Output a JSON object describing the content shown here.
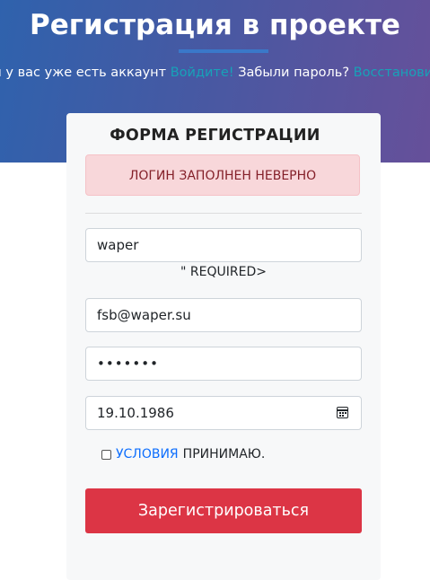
{
  "hero": {
    "title": "Регистрация в проекте",
    "sub_text1": "Если у вас уже есть аккаунт ",
    "login_link": "Войдите!",
    "sub_text2": " Забыли пароль? ",
    "restore_link": "Восстановить"
  },
  "form": {
    "title": "ФОРМА РЕГИСТРАЦИИ",
    "alert": "ЛОГИН ЗАПОЛНЕН НЕВЕРНО",
    "login_value": "waper",
    "required_note": "\" REQUIRED>",
    "email_value": "fsb@waper.su",
    "password_value": "•••••••",
    "birthdate_value": "19.10.1986",
    "terms_link": "УСЛОВИЯ",
    "terms_text": "ПРИНИМАЮ.",
    "submit_label": "Зарегистрироваться"
  },
  "colors": {
    "accent_link": "#17a2b8",
    "alert_bg": "#f8d7da",
    "submit_bg": "#dc3545"
  }
}
